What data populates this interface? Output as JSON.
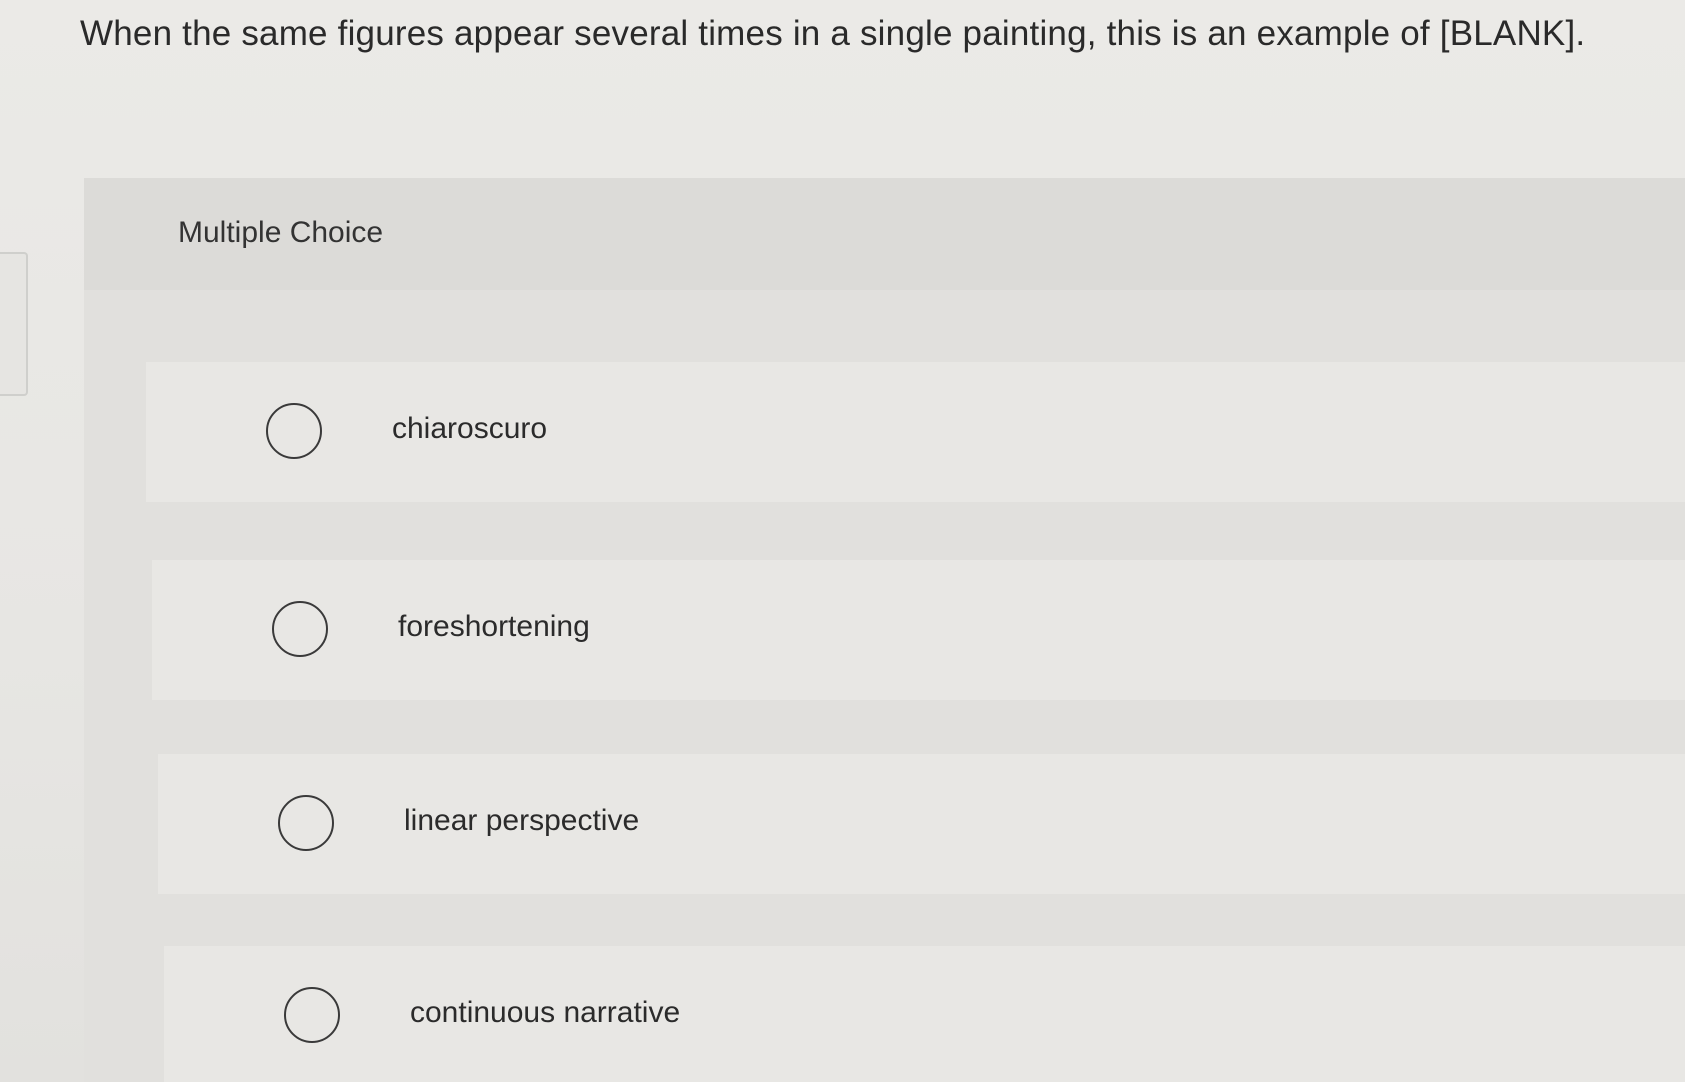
{
  "question": {
    "text": "When the same figures appear several times in a single painting, this is an example of [BLANK]."
  },
  "multiple_choice": {
    "label": "Multiple Choice",
    "options": [
      {
        "label": "chiaroscuro"
      },
      {
        "label": "foreshortening"
      },
      {
        "label": "linear perspective"
      },
      {
        "label": "continuous narrative"
      }
    ]
  }
}
